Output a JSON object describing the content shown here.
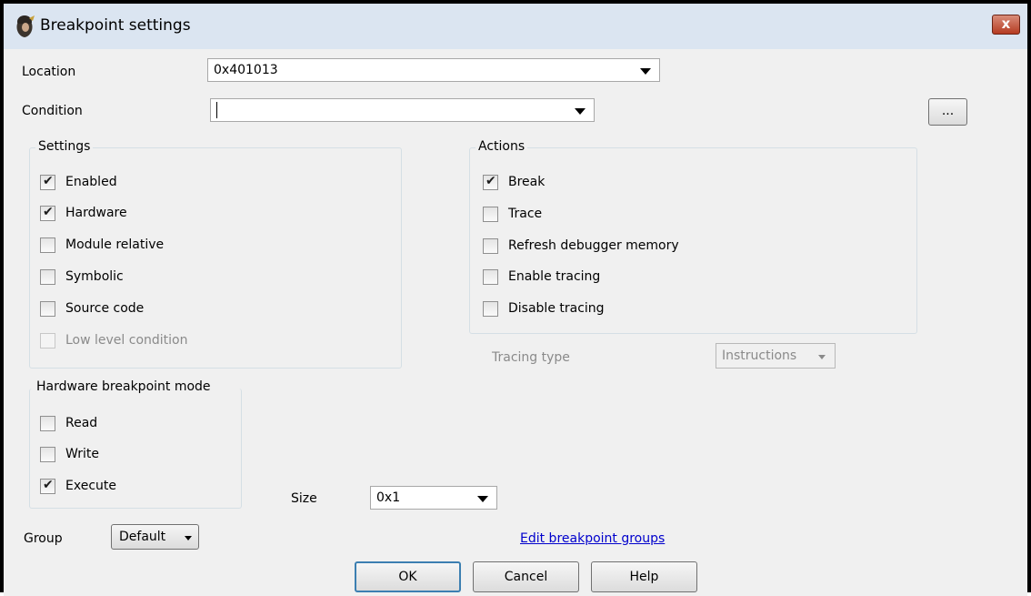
{
  "window": {
    "title": "Breakpoint settings",
    "close_glyph": "x"
  },
  "location": {
    "label": "Location",
    "value": "0x401013"
  },
  "condition": {
    "label": "Condition",
    "value": "",
    "browse_label": "..."
  },
  "settings": {
    "title": "Settings",
    "items": [
      {
        "label": "Enabled",
        "checked": true,
        "enabled": true
      },
      {
        "label": "Hardware",
        "checked": true,
        "enabled": true
      },
      {
        "label": "Module relative",
        "checked": false,
        "enabled": true
      },
      {
        "label": "Symbolic",
        "checked": false,
        "enabled": true
      },
      {
        "label": "Source code",
        "checked": false,
        "enabled": true
      },
      {
        "label": "Low level condition",
        "checked": false,
        "enabled": false
      }
    ]
  },
  "actions": {
    "title": "Actions",
    "items": [
      {
        "label": "Break",
        "checked": true
      },
      {
        "label": "Trace",
        "checked": false
      },
      {
        "label": "Refresh debugger memory",
        "checked": false
      },
      {
        "label": "Enable tracing",
        "checked": false
      },
      {
        "label": "Disable tracing",
        "checked": false
      }
    ]
  },
  "tracing": {
    "label": "Tracing type",
    "value": "Instructions"
  },
  "hw_mode": {
    "title": "Hardware breakpoint mode",
    "items": [
      {
        "label": "Read",
        "checked": false
      },
      {
        "label": "Write",
        "checked": false
      },
      {
        "label": "Execute",
        "checked": true
      }
    ]
  },
  "size": {
    "label": "Size",
    "value": "0x1"
  },
  "group": {
    "label": "Group",
    "value": "Default"
  },
  "edit_groups_link": "Edit breakpoint groups",
  "buttons": {
    "ok": "OK",
    "cancel": "Cancel",
    "help": "Help"
  },
  "icons": {
    "app": "tracer-icon",
    "close": "close-icon",
    "dropdown": "chevron-down-icon"
  },
  "colors": {
    "titlebar": "#dbe5f1",
    "close": "#c0442b",
    "link": "#0000cc"
  }
}
